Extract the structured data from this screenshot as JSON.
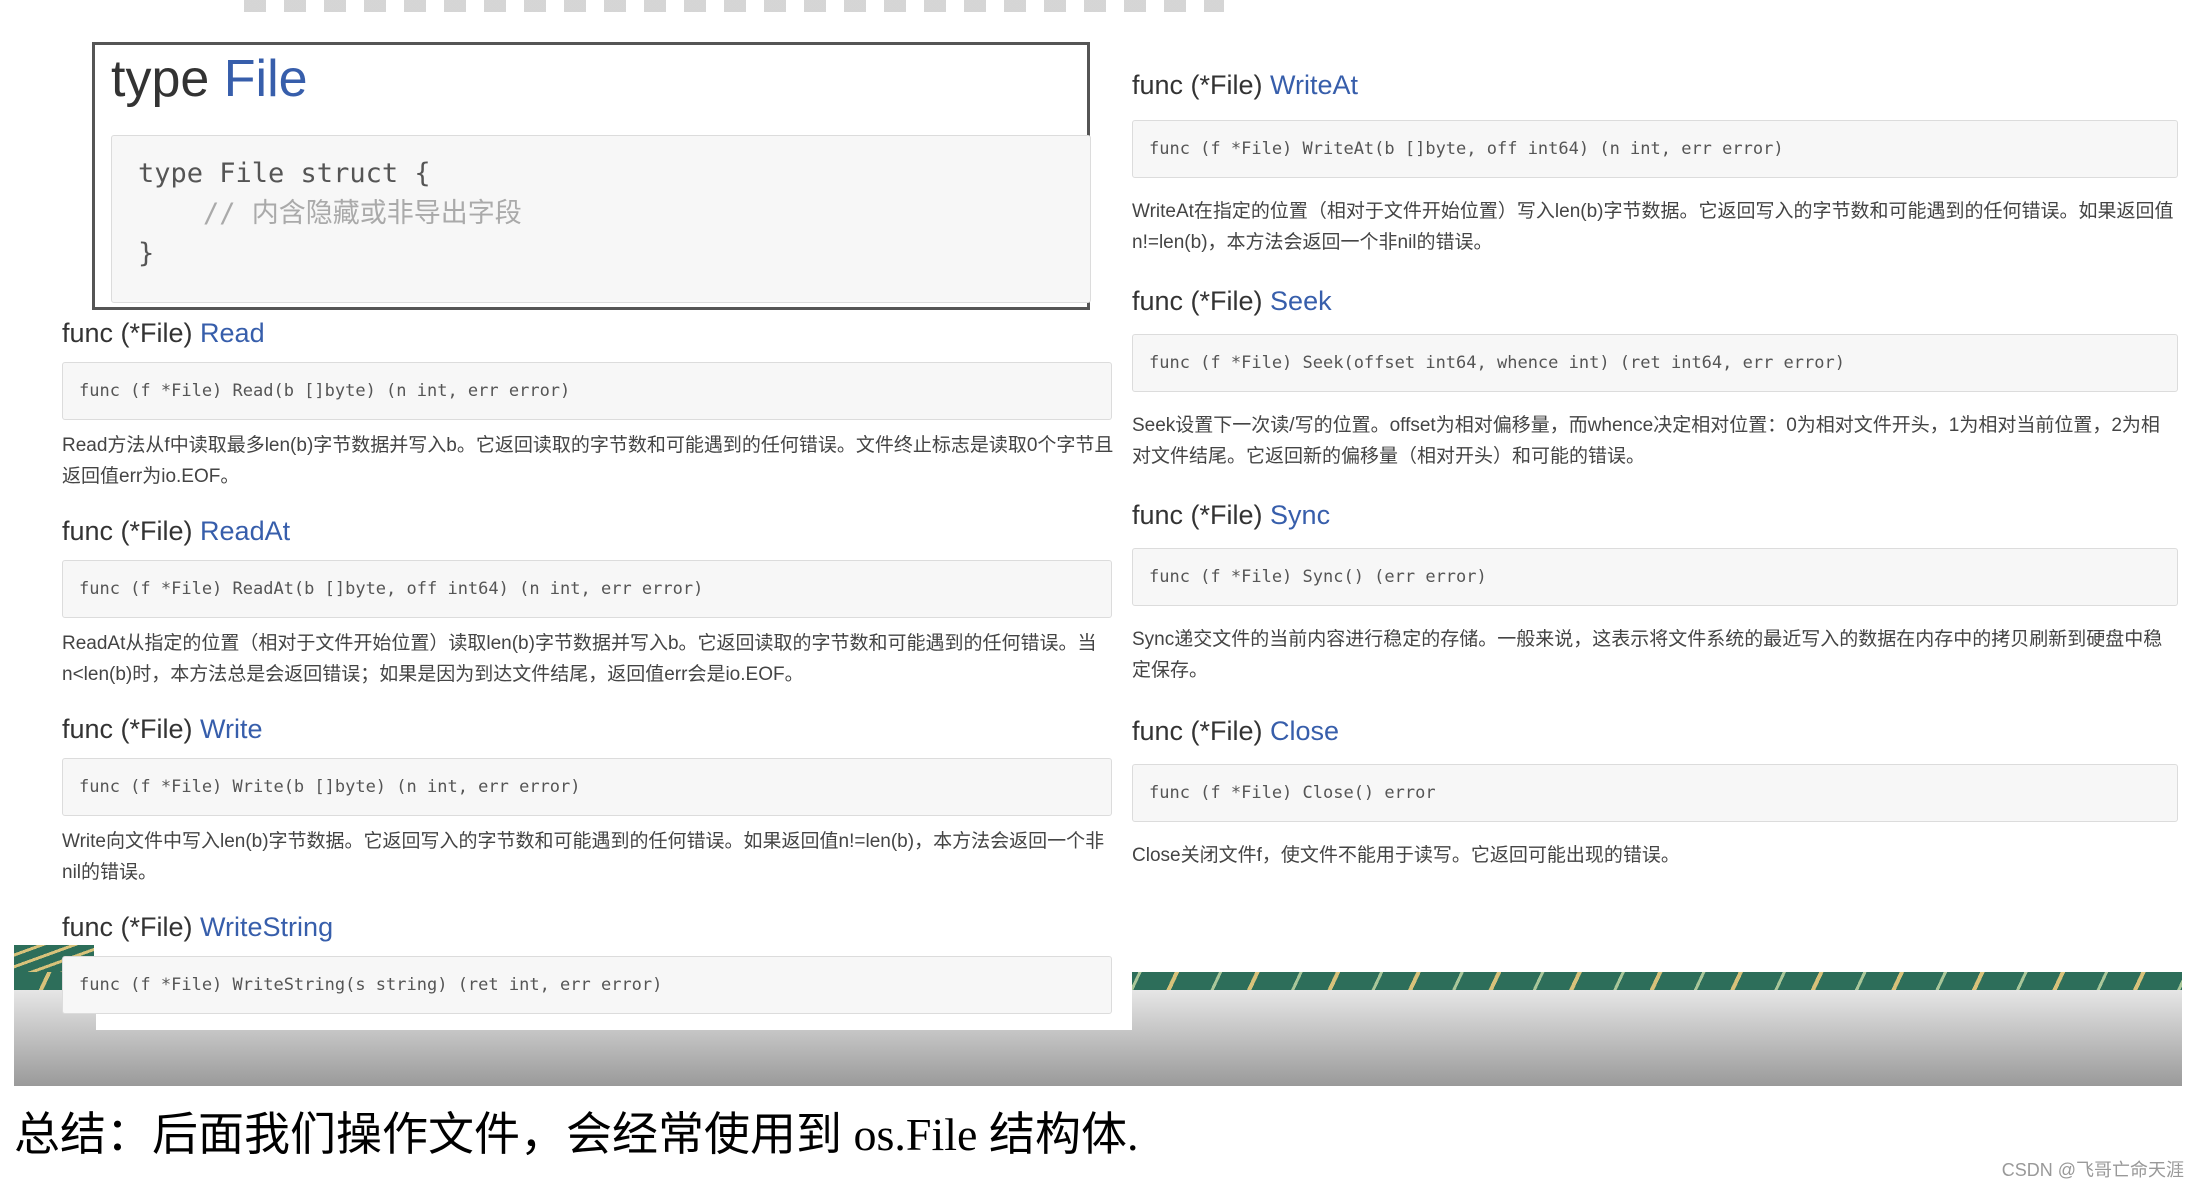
{
  "type_section": {
    "keyword": "type",
    "name": "File",
    "code_line1": "type File struct {",
    "code_comment": "    // 内含隐藏或非导出字段",
    "code_line3": "}"
  },
  "left_funcs": [
    {
      "prefix": "func (*File) ",
      "name": "Read",
      "signature": "func (f *File) Read(b []byte) (n int, err error)",
      "description": "Read方法从f中读取最多len(b)字节数据并写入b。它返回读取的字节数和可能遇到的任何错误。文件终止标志是读取0个字节且返回值err为io.EOF。"
    },
    {
      "prefix": "func (*File) ",
      "name": "ReadAt",
      "signature": "func (f *File) ReadAt(b []byte, off int64) (n int, err error)",
      "description": "ReadAt从指定的位置（相对于文件开始位置）读取len(b)字节数据并写入b。它返回读取的字节数和可能遇到的任何错误。当n<len(b)时，本方法总是会返回错误；如果是因为到达文件结尾，返回值err会是io.EOF。"
    },
    {
      "prefix": "func (*File) ",
      "name": "Write",
      "signature": "func (f *File) Write(b []byte) (n int, err error)",
      "description": "Write向文件中写入len(b)字节数据。它返回写入的字节数和可能遇到的任何错误。如果返回值n!=len(b)，本方法会返回一个非nil的错误。"
    },
    {
      "prefix": "func (*File) ",
      "name": "WriteString",
      "signature": "func (f *File) WriteString(s string) (ret int, err error)",
      "description": ""
    }
  ],
  "right_funcs": [
    {
      "prefix": "func (*File) ",
      "name": "WriteAt",
      "signature": "func (f *File) WriteAt(b []byte, off int64) (n int, err error)",
      "description": "WriteAt在指定的位置（相对于文件开始位置）写入len(b)字节数据。它返回写入的字节数和可能遇到的任何错误。如果返回值n!=len(b)，本方法会返回一个非nil的错误。"
    },
    {
      "prefix": "func (*File) ",
      "name": "Seek",
      "signature": "func (f *File) Seek(offset int64, whence int) (ret int64, err error)",
      "description": "Seek设置下一次读/写的位置。offset为相对偏移量，而whence决定相对位置：0为相对文件开头，1为相对当前位置，2为相对文件结尾。它返回新的偏移量（相对开头）和可能的错误。"
    },
    {
      "prefix": "func (*File) ",
      "name": "Sync",
      "signature": "func (f *File) Sync() (err error)",
      "description": "Sync递交文件的当前内容进行稳定的存储。一般来说，这表示将文件系统的最近写入的数据在内存中的拷贝刷新到硬盘中稳定保存。"
    },
    {
      "prefix": "func (*File) ",
      "name": "Close",
      "signature": "func (f *File) Close() error",
      "description": "Close关闭文件f，使文件不能用于读写。它返回可能出现的错误。"
    }
  ],
  "summary": "总结：后面我们操作文件，会经常使用到 os.File 结构体.",
  "watermark": "CSDN @飞哥亡命天涯"
}
